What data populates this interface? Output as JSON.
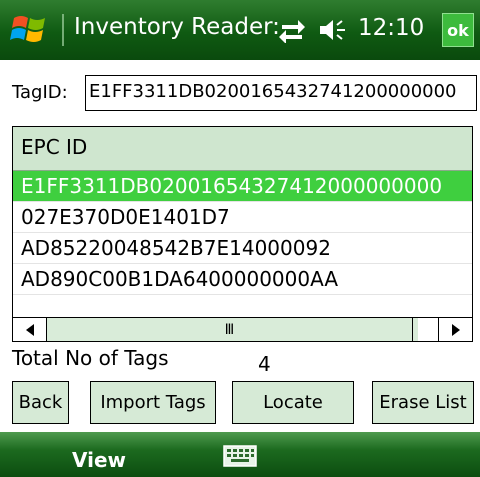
{
  "status_bar": {
    "title": "Inventory Reader:",
    "clock": "12:10",
    "ok_label": "ok",
    "icons": [
      "windows-logo-icon",
      "connectivity-icon",
      "volume-icon"
    ]
  },
  "tag_id": {
    "label": "TagID:",
    "value": "E1FF3311DB0200165432741200000000"
  },
  "epc_list": {
    "header": "EPC ID",
    "rows": [
      "E1FF3311DB02001654327412000000000",
      "027E370D0E1401D7",
      "AD85220048542B7E14000092",
      "AD890C00B1DA6400000000AA"
    ],
    "selected_index": 0,
    "scroll_thumb_label": "Ⅲ"
  },
  "total": {
    "label": "Total No of Tags",
    "value": "4"
  },
  "buttons": {
    "back": "Back",
    "import": "Import Tags",
    "locate": "Locate",
    "erase": "Erase List"
  },
  "menu_bar": {
    "left": "View",
    "keyboard_icon": "keyboard-icon"
  },
  "colors": {
    "accent_green": "#3fcf3f",
    "bar_green": "#0f5a12",
    "button_bg": "#d6ead6"
  }
}
